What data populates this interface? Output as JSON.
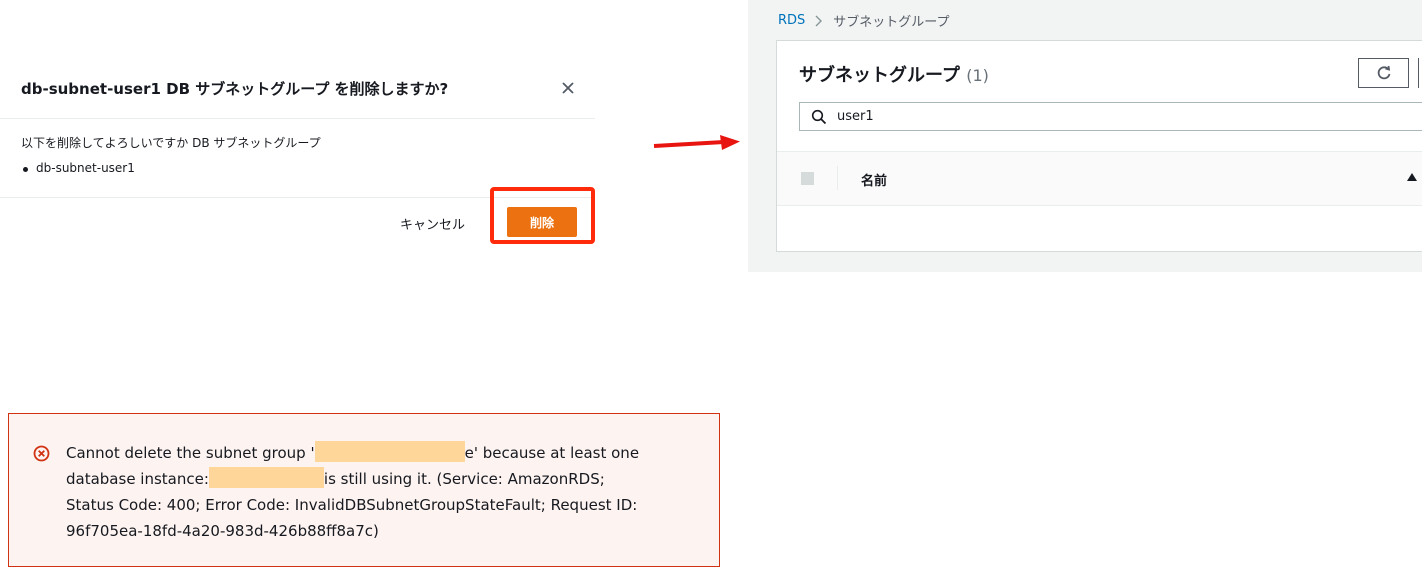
{
  "modal": {
    "title": "db-subnet-user1 DB サブネットグループ を削除しますか?",
    "close_icon": "close-icon",
    "message": "以下を削除してよろしいですか DB サブネットグループ",
    "items": [
      "db-subnet-user1"
    ],
    "cancel_label": "キャンセル",
    "delete_label": "削除"
  },
  "rds": {
    "breadcrumb": {
      "root": "RDS",
      "current": "サブネットグループ"
    },
    "title": "サブネットグループ",
    "count": "(1)",
    "search_value": "user1",
    "columns": [
      "名前"
    ]
  },
  "error": {
    "line1_a": "Cannot delete the subnet group '",
    "line1_b": "e' because at least one",
    "line2_a": "database instance:",
    "line2_b": "is still using it. (Service: AmazonRDS;",
    "line3": "Status Code: 400; Error Code: InvalidDBSubnetGroupStateFault; Request ID:",
    "line4": "96f705ea-18fd-4a20-983d-426b88ff8a7c)"
  },
  "colors": {
    "accent_orange": "#ec7211",
    "highlight_red": "#ff2b0a",
    "link_blue": "#0073bb",
    "error_border": "#d13212",
    "redaction": "#ffd69a"
  }
}
